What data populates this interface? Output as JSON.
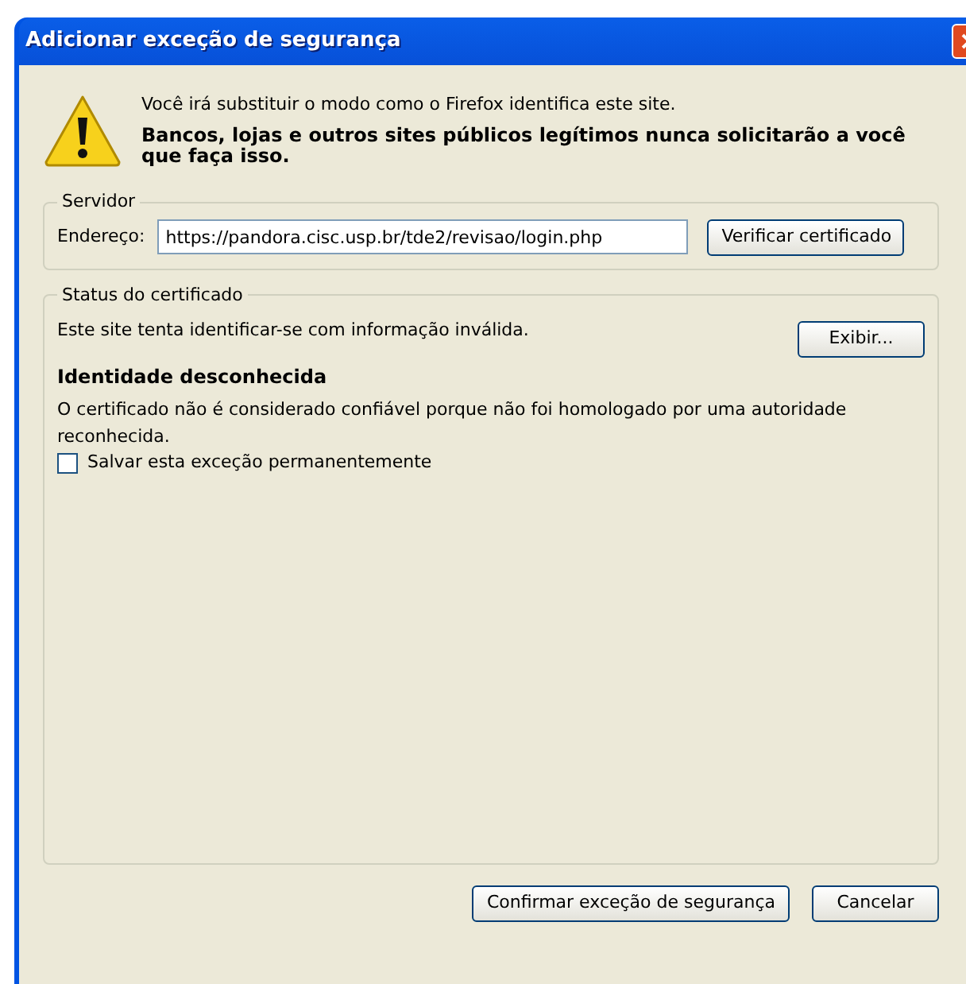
{
  "window": {
    "title": "Adicionar exceção de segurança"
  },
  "warning": {
    "message": "Você irá substituir o modo como o Firefox identifica este site.",
    "emphasis": "Bancos, lojas e outros sites públicos legítimos nunca solicitarão a você que faça isso."
  },
  "server": {
    "legend": "Servidor",
    "address_label": "Endereço:",
    "address": "https://pandora.cisc.usp.br/tde2/revisao/login.php",
    "verify_button": "Verificar certificado"
  },
  "status": {
    "legend": "Status do certificado",
    "summary": "Este site tenta identificar-se com informação inválida.",
    "view_button": "Exibir...",
    "heading": "Identidade desconhecida",
    "detail": "O certificado não é considerado confiável porque não foi homologado por uma autoridade reconhecida.",
    "save_checkbox": {
      "label": "Salvar esta exceção permanentemente",
      "checked": false
    }
  },
  "buttons": [
    {
      "label": "Confirmar exceção de segurança"
    },
    {
      "label": "Cancelar"
    }
  ]
}
